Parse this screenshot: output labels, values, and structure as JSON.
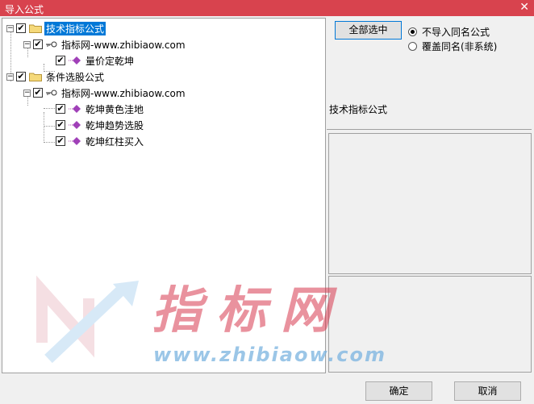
{
  "window": {
    "title": "导入公式",
    "close_glyph": "✕"
  },
  "tree": {
    "nodes": [
      {
        "label": "技术指标公式",
        "checked": true,
        "expander": "−",
        "icon": "folder-icon",
        "selected": true
      },
      {
        "label": "指标网-www.zhibiaow.com",
        "checked": true,
        "expander": "−",
        "icon": "key-icon"
      },
      {
        "label": "量价定乾坤",
        "checked": true,
        "icon": "formula-icon"
      },
      {
        "label": "条件选股公式",
        "checked": true,
        "expander": "−",
        "icon": "folder-icon"
      },
      {
        "label": "指标网-www.zhibiaow.com",
        "checked": true,
        "expander": "−",
        "icon": "key-icon"
      },
      {
        "label": "乾坤黄色洼地",
        "checked": true,
        "icon": "formula-icon"
      },
      {
        "label": "乾坤趋势选股",
        "checked": true,
        "icon": "formula-icon"
      },
      {
        "label": "乾坤红柱买入",
        "checked": true,
        "icon": "formula-icon"
      }
    ]
  },
  "buttons": {
    "select_all": "全部选中",
    "ok": "确定",
    "cancel": "取消"
  },
  "options": {
    "no_import_same": "不导入同名公式",
    "overwrite_same": "覆盖同名(非系统)",
    "selected": "no_import_same"
  },
  "info": {
    "text": "技术指标公式"
  },
  "watermark": {
    "brand": "指标网",
    "url": "www.zhibiaow.com"
  },
  "colors": {
    "titlebar": "#d8434e",
    "selection": "#0078d7",
    "watermark_red": "#d83a4f",
    "watermark_blue": "#7ab3e0"
  }
}
